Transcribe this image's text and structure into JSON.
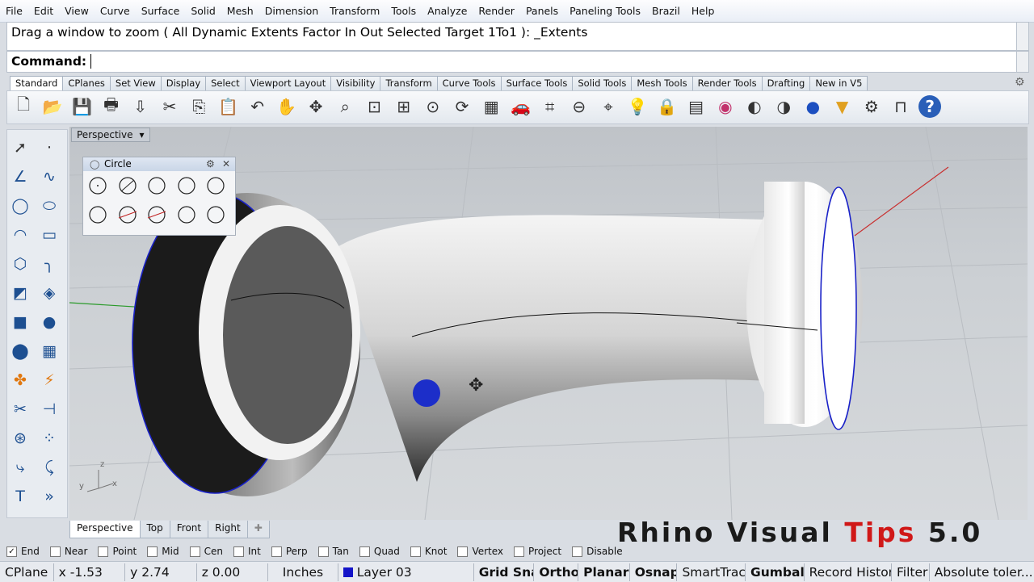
{
  "menu": [
    "File",
    "Edit",
    "View",
    "Curve",
    "Surface",
    "Solid",
    "Mesh",
    "Dimension",
    "Transform",
    "Tools",
    "Analyze",
    "Render",
    "Panels",
    "Paneling Tools",
    "Brazil",
    "Help"
  ],
  "command": {
    "history": "Drag a window to zoom ( All  Dynamic  Extents  Factor  In  Out  Selected  Target  1To1 ): _Extents",
    "prompt_label": "Command:"
  },
  "toolbar_tabs": [
    "Standard",
    "CPlanes",
    "Set View",
    "Display",
    "Select",
    "Viewport Layout",
    "Visibility",
    "Transform",
    "Curve Tools",
    "Surface Tools",
    "Solid Tools",
    "Mesh Tools",
    "Render Tools",
    "Drafting",
    "New in V5"
  ],
  "toolbar_icons": [
    "new-file-icon",
    "open-folder-icon",
    "save-icon",
    "print-icon",
    "import-icon",
    "cut-icon",
    "copy-icon",
    "paste-icon",
    "undo-icon",
    "pan-hand-icon",
    "rotate-view-icon",
    "zoom-icon",
    "zoom-window-icon",
    "zoom-extents-icon",
    "zoom-selected-icon",
    "rotate-icon",
    "four-view-icon",
    "car-icon",
    "grid-icon",
    "point-icon",
    "snap-icon",
    "lightbulb-icon",
    "lock-icon",
    "layer-icon",
    "color-wheel-icon",
    "shade-icon",
    "rendered-icon",
    "sphere-icon",
    "filter-icon",
    "gear-icon",
    "properties-icon",
    "help-icon"
  ],
  "viewport": {
    "title": "Perspective",
    "axes": {
      "z": "z",
      "y": "y",
      "x": "x"
    }
  },
  "circle_panel": {
    "title": "Circle"
  },
  "viewport_tabs": [
    "Perspective",
    "Top",
    "Front",
    "Right"
  ],
  "watermark": {
    "part1": "Rhino Visual ",
    "part2": "Tips",
    "part3": " 5.0"
  },
  "osnaps": [
    {
      "label": "End",
      "checked": true
    },
    {
      "label": "Near",
      "checked": false
    },
    {
      "label": "Point",
      "checked": false
    },
    {
      "label": "Mid",
      "checked": false
    },
    {
      "label": "Cen",
      "checked": false
    },
    {
      "label": "Int",
      "checked": false
    },
    {
      "label": "Perp",
      "checked": false
    },
    {
      "label": "Tan",
      "checked": false
    },
    {
      "label": "Quad",
      "checked": false
    },
    {
      "label": "Knot",
      "checked": false
    },
    {
      "label": "Vertex",
      "checked": false
    },
    {
      "label": "Project",
      "checked": false
    },
    {
      "label": "Disable",
      "checked": false
    }
  ],
  "status": {
    "cplane": "CPlane",
    "x": "x -1.53",
    "y": "y 2.74",
    "z": "z 0.00",
    "units": "Inches",
    "layer": "Layer 03",
    "layer_color": "#1414c8",
    "grid_snap": "Grid Sna",
    "ortho": "Ortho",
    "planar": "Planar",
    "osnap": "Osnap",
    "smarttrack": "SmartTrack",
    "gumball": "Gumbal",
    "record_history": "Record Histor",
    "filter": "Filter",
    "tolerance": "Absolute toler..."
  },
  "colors": {
    "accent": "#1d4f91",
    "watermark_red": "#d01818",
    "edge_blue": "#1a22c8"
  }
}
